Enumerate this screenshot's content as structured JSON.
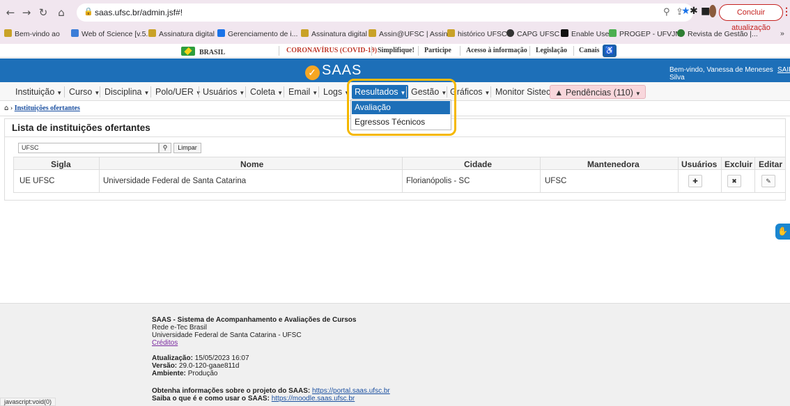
{
  "browser": {
    "url": "saas.ufsc.br/admin.jsf#!",
    "update_label": "Concluir atualização",
    "bookmarks": [
      "Bem-vindo ao",
      "Web of Science [v.5...",
      "Assinatura digital",
      "Gerenciamento de i...",
      "Assinatura digital",
      "Assin@UFSC | Assin...",
      "histórico UFSC",
      "CAPG UFSC",
      "Enable User",
      "PROGEP - UFVJM",
      "Revista de Gestão |..."
    ],
    "bookmarks_more": "»"
  },
  "gov_bar": {
    "brasil": "BRASIL",
    "links": [
      "CORONAVÍRUS (COVID-19)",
      "Simplifique!",
      "Participe",
      "Acesso à informação",
      "Legislação",
      "Canais"
    ]
  },
  "header": {
    "logo": "SAAS",
    "welcome": "Bem-vindo, Vanessa de Meneses Silva",
    "logout": "SAIR"
  },
  "menu": {
    "items": [
      "Instituição",
      "Curso",
      "Disciplina",
      "Polo/UER",
      "Usuários",
      "Coleta",
      "Email",
      "Logs",
      "Resultados",
      "Gestão",
      "Gráficos",
      "Monitor Sistec"
    ],
    "pending": "Pendências (110)"
  },
  "dropdown": {
    "items": [
      "Avaliação",
      "Egressos Técnicos"
    ]
  },
  "breadcrumb": {
    "current": "Instituições ofertantes"
  },
  "page": {
    "title": "Lista de instituições ofertantes",
    "filter_value": "UFSC",
    "clear_label": "Limpar"
  },
  "table": {
    "headers": [
      "Sigla",
      "Nome",
      "Cidade",
      "Mantenedora",
      "Usuários",
      "Excluir",
      "Editar"
    ],
    "rows": [
      {
        "sigla": "UE UFSC",
        "nome": "Universidade Federal de Santa Catarina",
        "cidade": "Florianópolis - SC",
        "mantenedora": "UFSC"
      }
    ]
  },
  "footer": {
    "title": "SAAS - Sistema de Acompanhamento e Avaliações de Cursos",
    "line1": "Rede e-Tec Brasil",
    "line2": "Universidade Federal de Santa Catarina - UFSC",
    "credits": "Créditos",
    "update_label": "Atualização:",
    "update_value": "15/05/2023 16:07",
    "version_label": "Versão:",
    "version_value": "29.0-120-gaae811d",
    "env_label": "Ambiente:",
    "env_value": "Produção",
    "info1_label": "Obtenha informações sobre o projeto do SAAS:",
    "info1_link": "https://portal.saas.ufsc.br",
    "info2_label": "Saiba o que é e como usar o SAAS:",
    "info2_link": "https://moodle.saas.ufsc.br"
  },
  "status_bar": "javascript:void(0)",
  "colors": {
    "header_blue": "#1d6fb8",
    "highlight": "#f5b800",
    "pending_bg": "#f8d7dc"
  }
}
